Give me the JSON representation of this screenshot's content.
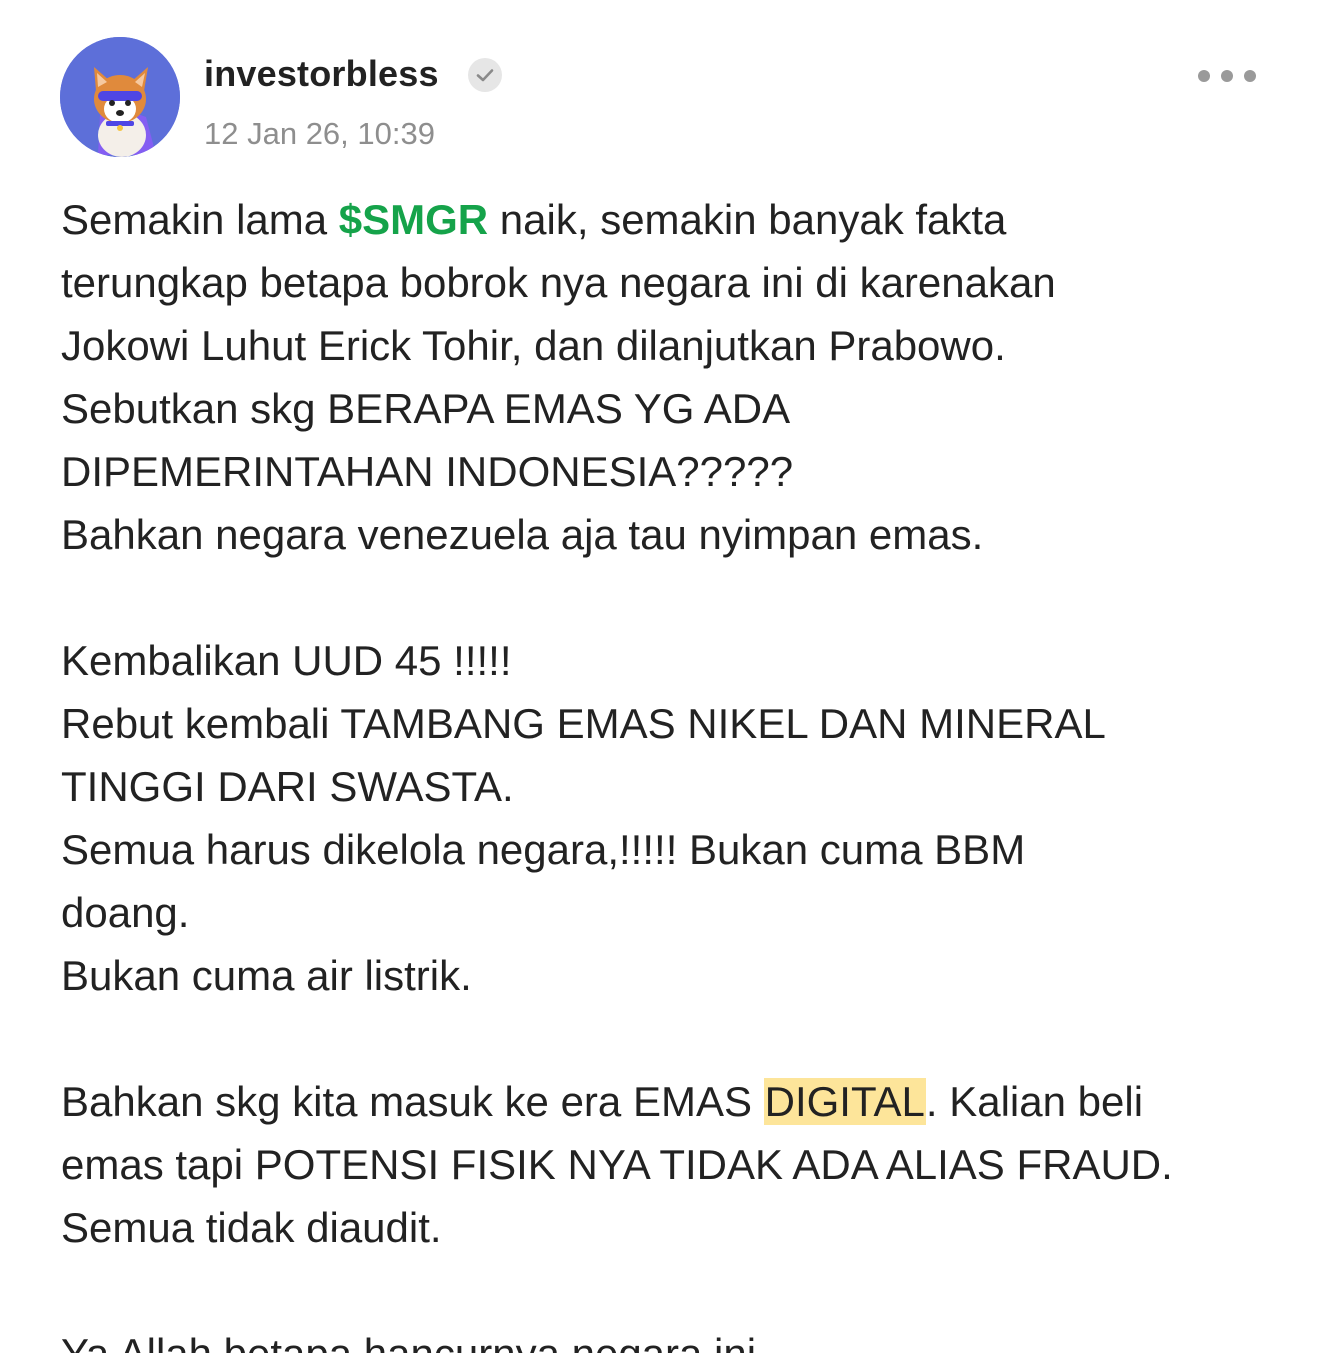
{
  "post": {
    "username": "investorbless",
    "timestamp": "12 Jan 26, 10:39",
    "verified": true,
    "menu_icon": "more-horizontal-icon",
    "accent_color": "#15a34a",
    "highlight_color": "#fde59a"
  },
  "content": {
    "l1_a": "Semakin lama ",
    "l1_ticker": "$SMGR",
    "l1_b": " naik, semakin banyak fakta",
    "l2": "terungkap betapa bobrok nya negara ini di karenakan",
    "l3": "Jokowi Luhut Erick Tohir, dan dilanjutkan Prabowo.",
    "l4": "Sebutkan skg BERAPA EMAS YG ADA",
    "l5": "DIPEMERINTAHAN INDONESIA?????",
    "l6": "Bahkan negara venezuela aja tau nyimpan emas.",
    "l8": "Kembalikan UUD 45 !!!!!",
    "l9": "Rebut kembali TAMBANG EMAS NIKEL DAN MINERAL",
    "l10": "TINGGI DARI SWASTA.",
    "l11": "Semua harus dikelola negara,!!!!! Bukan cuma BBM",
    "l12": "doang.",
    "l13": "Bukan cuma air listrik.",
    "l15_a": "Bahkan skg kita masuk ke era EMAS ",
    "l15_highlight": "DIGITAL",
    "l15_b": ". Kalian beli",
    "l16": "emas tapi POTENSI FISIK NYA TIDAK ADA ALIAS FRAUD.",
    "l17": "Semua tidak diaudit.",
    "l19": "Ya Allah betapa hancurnya negara ini"
  }
}
